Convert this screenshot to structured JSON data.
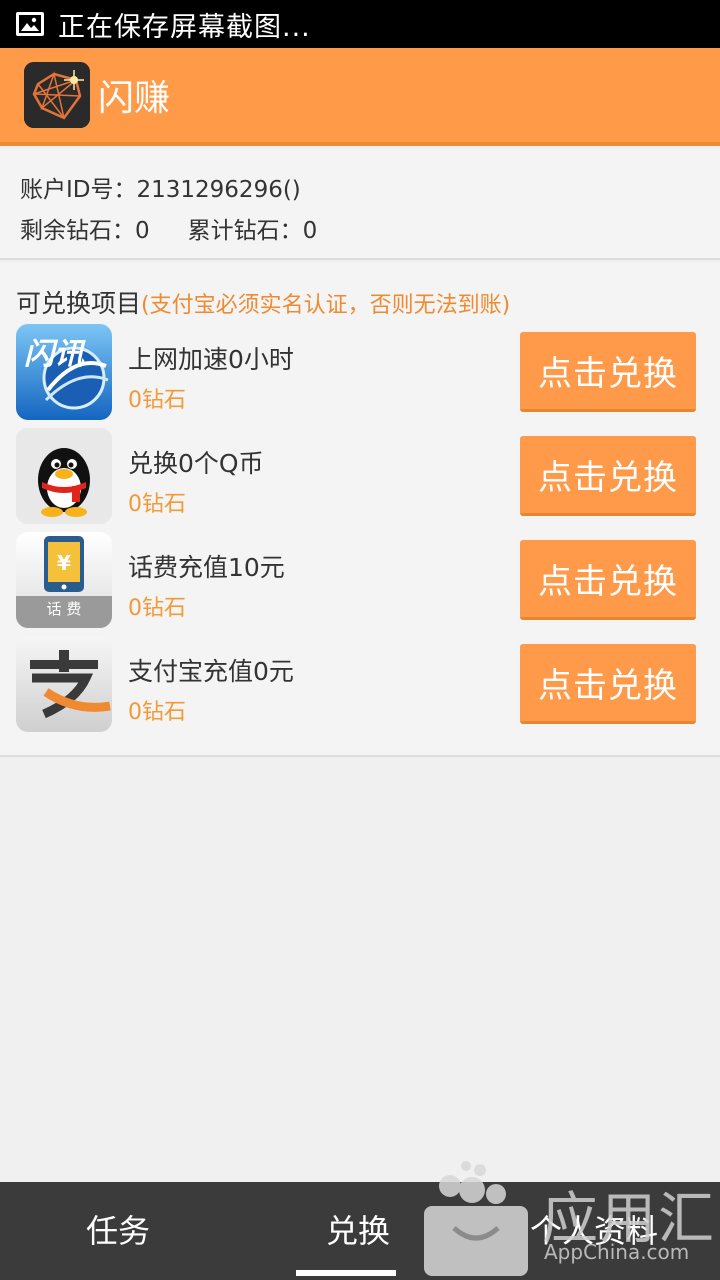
{
  "status_bar": {
    "text": "正在保存屏幕截图..."
  },
  "app_bar": {
    "title": "闪赚"
  },
  "account": {
    "id_label": "账户ID号：",
    "id_value": "2131296296()",
    "remaining_label": "剩余钻石：",
    "remaining_value": "0",
    "total_label": "累计钻石：",
    "total_value": "0"
  },
  "section": {
    "title": "可兑换项目",
    "note": "(支付宝必须实名认证，否则无法到账)"
  },
  "items": [
    {
      "name": "上网加速0小时",
      "cost": "0钻石",
      "button": "点击兑换",
      "icon": "flash-browser-icon"
    },
    {
      "name": "兑换0个Q币",
      "cost": "0钻石",
      "button": "点击兑换",
      "icon": "qq-penguin-icon"
    },
    {
      "name": "话费充值10元",
      "cost": "0钻石",
      "button": "点击兑换",
      "icon": "phone-bill-icon",
      "icon_label": "话 费"
    },
    {
      "name": "支付宝充值0元",
      "cost": "0钻石",
      "button": "点击兑换",
      "icon": "alipay-icon"
    }
  ],
  "tabs": [
    {
      "label": "任务"
    },
    {
      "label": "兑换",
      "active": true
    },
    {
      "label": "个人资料"
    }
  ],
  "watermark": {
    "text": "应用汇",
    "sub": "AppChina.com"
  },
  "colors": {
    "accent": "#ff9a48",
    "cost_text": "#f39a38",
    "tabbar": "#3b3b3b"
  }
}
